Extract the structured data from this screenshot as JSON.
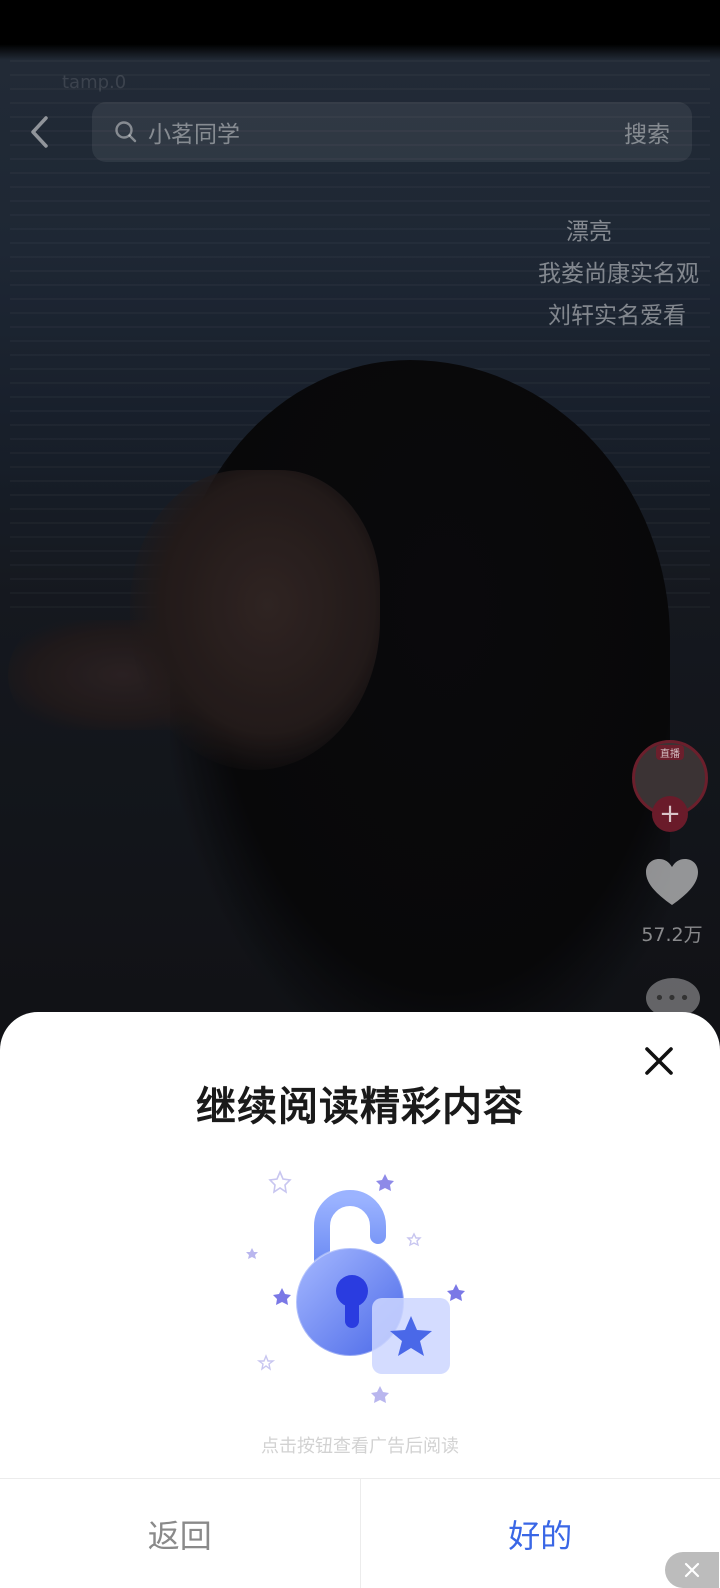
{
  "search": {
    "query": "小茗同学",
    "submit_label": "搜索",
    "handle_faded": "tamp.0"
  },
  "comments": [
    "漂亮",
    "我娄尚康实名观",
    "刘轩实名爱看"
  ],
  "right_rail": {
    "live_badge": "直播",
    "follow_symbol": "+",
    "like_count": "57.2万",
    "comment_symbol": "•••"
  },
  "dialog": {
    "title": "继续阅读精彩内容",
    "hint": "点击按钮查看广告后阅读",
    "back_label": "返回",
    "ok_label": "好的"
  },
  "colors": {
    "accent": "#3a67e6",
    "title": "#1a1a1a",
    "back_text": "#8a8a8a",
    "hint": "#d2d2d2",
    "sheet_bg": "#ffffff",
    "lock_primary": "#4a68e8",
    "star": "#7a78e6"
  },
  "icons": {
    "back": "chevron-left-icon",
    "search": "search-icon",
    "like": "heart-icon",
    "comment": "more-dots-icon",
    "close": "close-icon",
    "illustration": "unlock-padlock-icon",
    "float_close": "close-icon"
  }
}
